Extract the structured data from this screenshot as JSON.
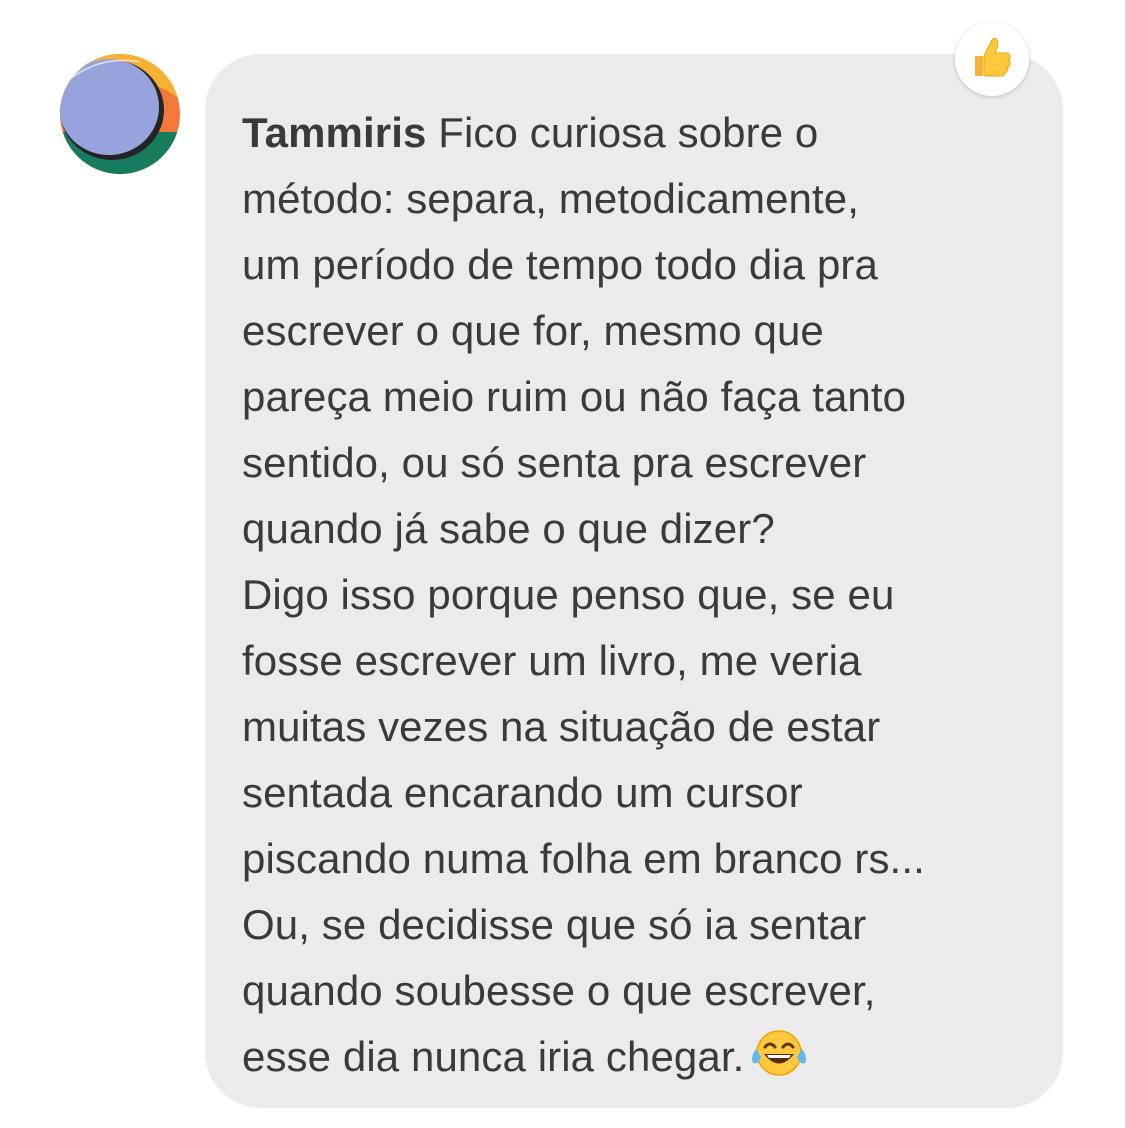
{
  "message": {
    "author": "Tammiris",
    "text": "Fico curiosa sobre o\nmétodo: separa, metodicamente,\num período de tempo todo dia pra\nescrever o que for, mesmo que\npareça meio ruim ou não faça tanto\nsentido, ou só senta pra escrever\nquando já sabe o que dizer?\nDigo isso porque penso que, se eu\nfosse escrever um livro, me veria\nmuitas vezes na situação de estar\nsentada encarando um cursor\npiscando numa folha em branco rs...\nOu, se decidisse que só ia sentar\nquando soubesse o que escrever,\nesse dia nunca iria chegar.",
    "trailing_emoji": "face-with-tears-of-joy-icon"
  },
  "reaction": {
    "emoji": "thumbs-up-icon"
  },
  "colors": {
    "bubble_background": "#ebebeb",
    "text": "#3a3a3c",
    "avatar_purple": "#97a3dc",
    "avatar_orange": "#f2793a",
    "avatar_yellow": "#f5b233",
    "avatar_green": "#167b5f"
  }
}
